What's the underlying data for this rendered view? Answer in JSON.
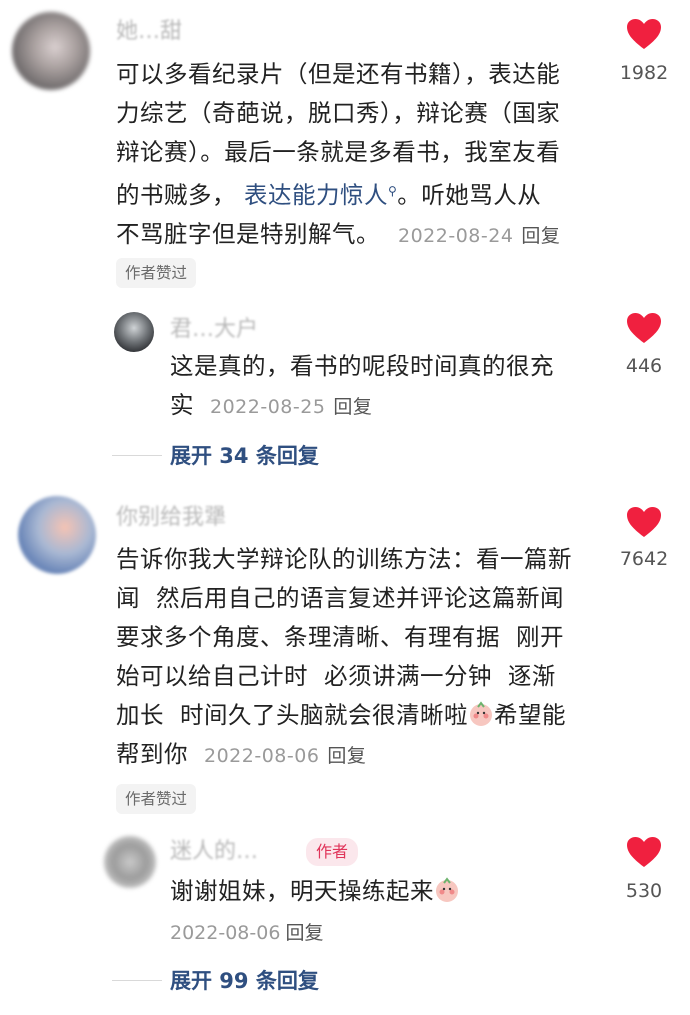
{
  "comments": [
    {
      "user": "她…甜",
      "text_lines": [
        "可以多看纪录片（但是还有书籍），表达能",
        "力综艺（奇葩说，脱口秀），辩论赛（国家",
        "辩论赛）。最后一条就是多看书，我室友看"
      ],
      "line4_prefix": "的书贼多，",
      "line4_link": "表达能力惊人",
      "line4_suffix": "。听她骂人从",
      "line5": "不骂脏字但是特别解气。",
      "date": "2022-08-24",
      "reply_label": "回复",
      "like_count": "1982",
      "author_liked_label": "作者赞过"
    },
    {
      "user": "君…大户",
      "text_line1": "这是真的，看书的呢段时间真的很充",
      "text_line2": "实",
      "date": "2022-08-25",
      "reply_label": "回复",
      "like_count": "446",
      "expand_label": "展开 34 条回复"
    },
    {
      "user": "你别给我犟",
      "text_lines": [
        "告诉你我大学辩论队的训练方法：看一篇新",
        "闻  然后用自己的语言复述并评论这篇新闻",
        "要求多个角度、条理清晰、有理有据  刚开",
        "始可以给自己计时  必须讲满一分钟  逐渐"
      ],
      "line5_prefix": "加长  时间久了头脑就会很清晰啦",
      "line5_suffix": "希望能",
      "line6": "帮到你",
      "date": "2022-08-06",
      "reply_label": "回复",
      "like_count": "7642",
      "author_liked_label": "作者赞过"
    },
    {
      "user": "迷人的…",
      "author_tag": "作者",
      "text": "谢谢姐妹，明天操练起来",
      "date": "2022-08-06",
      "reply_label": "回复",
      "like_count": "530",
      "expand_label": "展开 99 条回复"
    }
  ],
  "colors": {
    "heart": "#f0203f",
    "link": "#2f4f80",
    "author_tag": "#e0345a"
  }
}
